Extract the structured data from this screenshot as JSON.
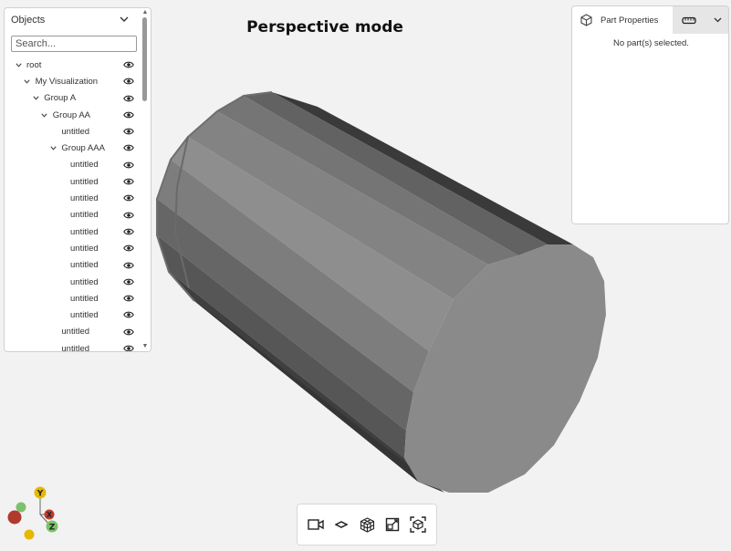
{
  "viewport": {
    "mode_title": "Perspective mode"
  },
  "objects_panel": {
    "title": "Objects",
    "search_placeholder": "Search...",
    "tree": [
      {
        "label": "root",
        "indent": 0,
        "caret": true
      },
      {
        "label": "My Visualization",
        "indent": 1,
        "caret": true
      },
      {
        "label": "Group A",
        "indent": 2,
        "caret": true
      },
      {
        "label": "Group AA",
        "indent": 3,
        "caret": true
      },
      {
        "label": "untitled",
        "indent": 4,
        "caret": false
      },
      {
        "label": "Group AAA",
        "indent": 4,
        "caret": true
      },
      {
        "label": "untitled",
        "indent": 5,
        "caret": false
      },
      {
        "label": "untitled",
        "indent": 5,
        "caret": false
      },
      {
        "label": "untitled",
        "indent": 5,
        "caret": false
      },
      {
        "label": "untitled",
        "indent": 5,
        "caret": false
      },
      {
        "label": "untitled",
        "indent": 5,
        "caret": false
      },
      {
        "label": "untitled",
        "indent": 5,
        "caret": false
      },
      {
        "label": "untitled",
        "indent": 5,
        "caret": false
      },
      {
        "label": "untitled",
        "indent": 5,
        "caret": false
      },
      {
        "label": "untitled",
        "indent": 5,
        "caret": false
      },
      {
        "label": "untitled",
        "indent": 5,
        "caret": false
      },
      {
        "label": "untitled",
        "indent": 4,
        "caret": false
      },
      {
        "label": "untitled",
        "indent": 4,
        "caret": false
      }
    ]
  },
  "part_properties": {
    "tab_label": "Part Properties",
    "empty_message": "No part(s) selected."
  },
  "toolbar": {
    "tools": [
      "camera-icon",
      "view-plane-icon",
      "cube-grid-icon",
      "fit-view-icon",
      "box-select-icon"
    ]
  },
  "axis_gizmo": {
    "labels": {
      "y": "Y",
      "x": "X",
      "z": "Z"
    },
    "colors": {
      "y": "#e6b800",
      "x": "#c0392b",
      "z": "#7cc26a"
    }
  },
  "colors": {
    "background": "#f2f2f2",
    "cylinder": "#8a8a8a"
  }
}
